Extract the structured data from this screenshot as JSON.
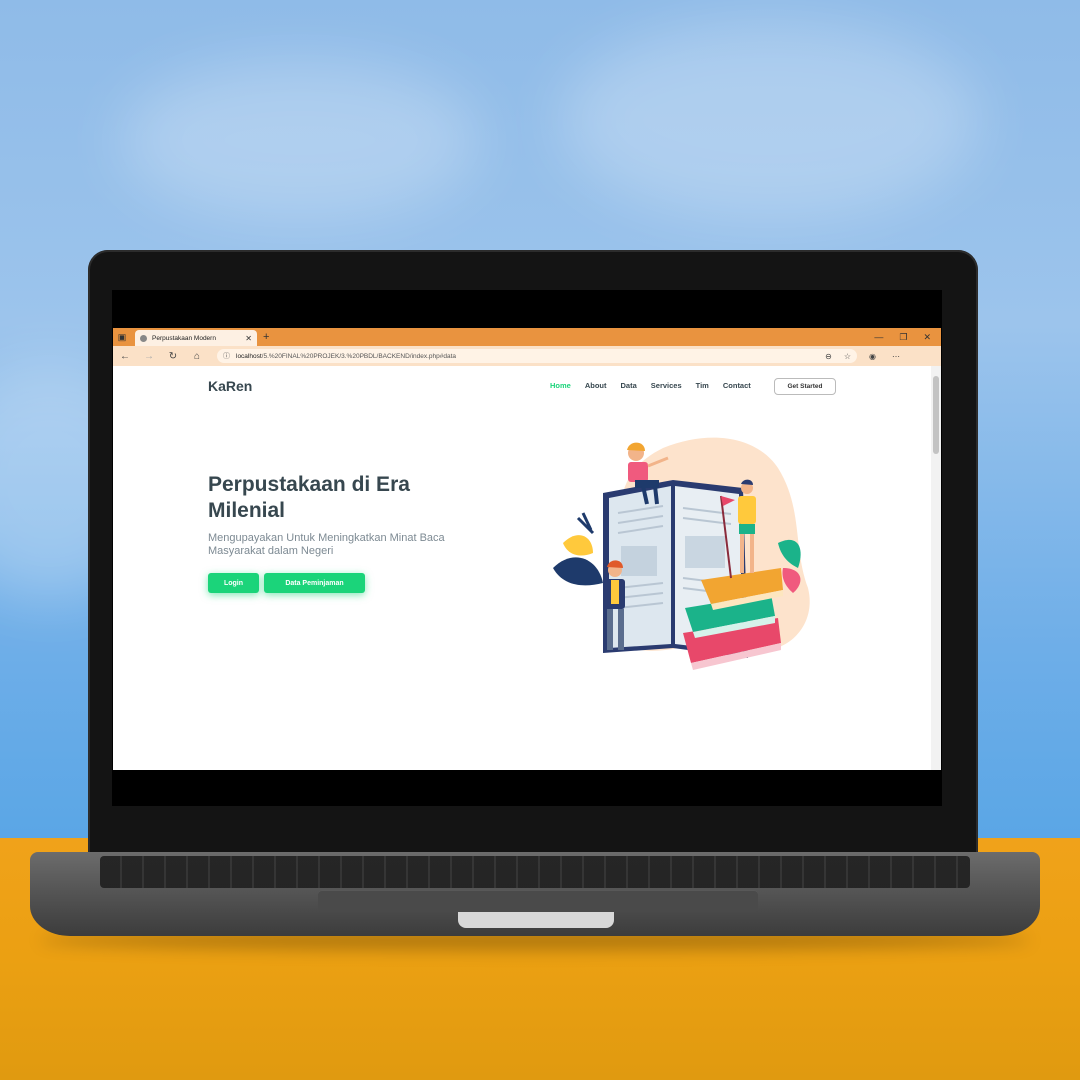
{
  "browser": {
    "tab_title": "Perpustakaan Modern",
    "url_host": "localhost",
    "url_path": "/5.%20FINAL%20PROJEK/3.%20PBDL/BACKEND/index.php#data"
  },
  "site": {
    "logo": "KaRen",
    "nav": [
      {
        "label": "Home",
        "active": true
      },
      {
        "label": "About"
      },
      {
        "label": "Data"
      },
      {
        "label": "Services"
      },
      {
        "label": "Tim"
      },
      {
        "label": "Contact"
      }
    ],
    "cta": "Get Started"
  },
  "hero": {
    "title": "Perpustakaan di Era Milenial",
    "subtitle": "Mengupayakan Untuk Meningkatkan Minat Baca Masyarakat dalam Negeri",
    "buttons": {
      "login": "Login",
      "data": "Data Peminjaman"
    }
  },
  "colors": {
    "accent": "#1bd47a",
    "browser_chrome": "#e9933f",
    "sky": "#6eaee8",
    "desk": "#eba012"
  }
}
